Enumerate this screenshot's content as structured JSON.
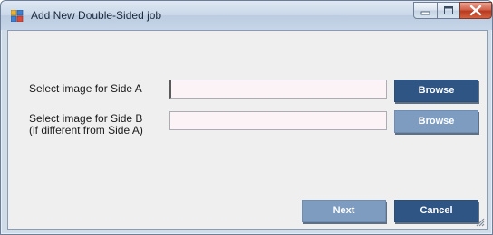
{
  "window": {
    "title": "Add New Double-Sided job"
  },
  "form": {
    "side_a_label": "Select image for Side A",
    "side_a_value": "",
    "side_b_label_line1": "Select image for Side B",
    "side_b_label_line2": "(if different from Side A)",
    "side_b_value": "",
    "browse_a_label": "Browse",
    "browse_b_label": "Browse"
  },
  "footer": {
    "next_label": "Next",
    "cancel_label": "Cancel"
  },
  "colors": {
    "primary_button": "#2f5585",
    "disabled_button": "#7d9cc0"
  }
}
